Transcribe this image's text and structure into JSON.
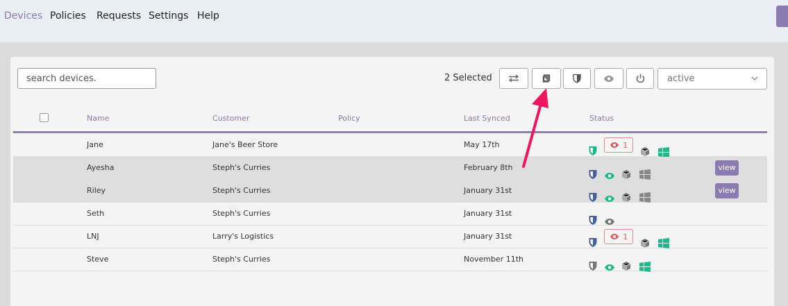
{
  "nav": {
    "items": [
      {
        "label": "Devices",
        "active": true
      },
      {
        "label": "Policies",
        "active": false
      },
      {
        "label": "Requests",
        "active": false
      },
      {
        "label": "Settings",
        "active": false
      },
      {
        "label": "Help",
        "active": false
      }
    ]
  },
  "toolbar": {
    "search_placeholder": "search devices.",
    "selected_text": "2 Selected",
    "buttons": [
      "transfer-icon",
      "book-icon",
      "shield-icon",
      "eye-icon",
      "power-icon"
    ],
    "status_value": "active"
  },
  "table": {
    "headers": {
      "name": "Name",
      "customer": "Customer",
      "policy": "Policy",
      "last_synced": "Last Synced",
      "status": "Status"
    },
    "rows": [
      {
        "name": "Jane",
        "customer": "Jane's Beer Store",
        "policy": "",
        "last_synced": "May 17th",
        "alert_count": "1",
        "selected": false
      },
      {
        "name": "Ayesha",
        "customer": "Steph's Curries",
        "policy": "",
        "last_synced": "February 8th",
        "view_label": "view",
        "selected": true
      },
      {
        "name": "Riley",
        "customer": "Steph's Curries",
        "policy": "",
        "last_synced": "January 31st",
        "view_label": "view",
        "selected": true
      },
      {
        "name": "Seth",
        "customer": "Steph's Curries",
        "policy": "",
        "last_synced": "January 31st",
        "selected": false
      },
      {
        "name": "LNJ",
        "customer": "Larry's Logistics",
        "policy": "",
        "last_synced": "January 31st",
        "alert_count": "1",
        "selected": false
      },
      {
        "name": "Steve",
        "customer": "Steph's Curries",
        "policy": "",
        "last_synced": "November 11th",
        "selected": false
      }
    ]
  },
  "colors": {
    "accent": "#8c7bb0",
    "green": "#1fb88a",
    "blue_shield": "#4a5f9e",
    "alert_red": "#e06060",
    "annotation_arrow": "#f0135f"
  }
}
